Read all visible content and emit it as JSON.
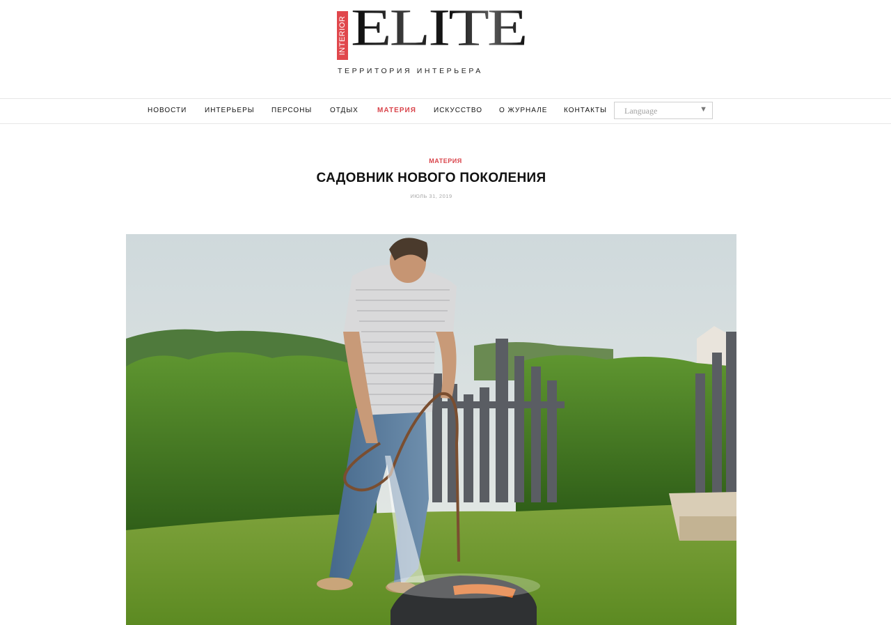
{
  "logo": {
    "tag": "INTERIOR",
    "word": "ELITE",
    "subtitle": "ТЕРРИТОРИЯ ИНТЕРЬЕРА"
  },
  "nav": {
    "items": [
      {
        "label": "НОВОСТИ",
        "active": false
      },
      {
        "label": "ИНТЕРЬЕРЫ",
        "active": false
      },
      {
        "label": "ПЕРСОНЫ",
        "active": false
      },
      {
        "label": "ОТДЫХ",
        "active": false
      },
      {
        "label": "МАТЕРИЯ",
        "active": true
      },
      {
        "label": "ИСКУССТВО",
        "active": false
      },
      {
        "label": "О ЖУРНАЛЕ",
        "active": false
      },
      {
        "label": "КОНТАКТЫ",
        "active": false
      }
    ],
    "language_select": {
      "value": "Language",
      "icon": "caret-down-icon"
    }
  },
  "article": {
    "category": "МАТЕРИЯ",
    "title": "САДОВНИК НОВОГО ПОКОЛЕНИЯ",
    "date": "ИЮЛЬ 31, 2019"
  },
  "colors": {
    "accent": "#d9444b",
    "logo_tag": "#e0474c",
    "nav_border": "#e6e6e6"
  }
}
